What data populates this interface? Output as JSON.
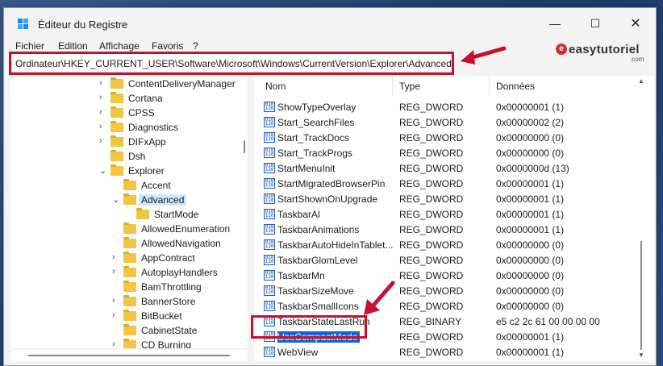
{
  "window": {
    "title": "Éditeur du Registre",
    "controls": {
      "minimize": "—",
      "maximize": "☐",
      "close": "✕"
    }
  },
  "menu": [
    "Fichier",
    "Edition",
    "Affichage",
    "Favoris",
    "?"
  ],
  "address": "Ordinateur\\HKEY_CURRENT_USER\\Software\\Microsoft\\Windows\\CurrentVersion\\Explorer\\Advanced",
  "logo": {
    "mark": "e",
    "name": "easytutoriel",
    "domain": ".com"
  },
  "tree": [
    {
      "label": "ContentDeliveryManager",
      "level": 1,
      "expander": "›"
    },
    {
      "label": "Cortana",
      "level": 1,
      "expander": "›"
    },
    {
      "label": "CPSS",
      "level": 1,
      "expander": "›"
    },
    {
      "label": "Diagnostics",
      "level": 1,
      "expander": "›"
    },
    {
      "label": "DIFxApp",
      "level": 1,
      "expander": "›"
    },
    {
      "label": "Dsh",
      "level": 1,
      "expander": ""
    },
    {
      "label": "Explorer",
      "level": 1,
      "expander": "⌄"
    },
    {
      "label": "Accent",
      "level": 2,
      "expander": ""
    },
    {
      "label": "Advanced",
      "level": 2,
      "expander": "⌄",
      "selected": true
    },
    {
      "label": "StartMode",
      "level": 3,
      "expander": ""
    },
    {
      "label": "AllowedEnumeration",
      "level": 2,
      "expander": ""
    },
    {
      "label": "AllowedNavigation",
      "level": 2,
      "expander": ""
    },
    {
      "label": "AppContract",
      "level": 2,
      "expander": "›"
    },
    {
      "label": "AutoplayHandlers",
      "level": 2,
      "expander": "›"
    },
    {
      "label": "BamThrottling",
      "level": 2,
      "expander": ""
    },
    {
      "label": "BannerStore",
      "level": 2,
      "expander": "›"
    },
    {
      "label": "BitBucket",
      "level": 2,
      "expander": "›"
    },
    {
      "label": "CabinetState",
      "level": 2,
      "expander": ""
    },
    {
      "label": "CD Burning",
      "level": 2,
      "expander": "›"
    }
  ],
  "columns": {
    "name": "Nom",
    "type": "Type",
    "data": "Données"
  },
  "values": [
    {
      "name": "ShowTypeOverlay",
      "type": "REG_DWORD",
      "data": "0x00000001 (1)"
    },
    {
      "name": "Start_SearchFiles",
      "type": "REG_DWORD",
      "data": "0x00000002 (2)"
    },
    {
      "name": "Start_TrackDocs",
      "type": "REG_DWORD",
      "data": "0x00000000 (0)"
    },
    {
      "name": "Start_TrackProgs",
      "type": "REG_DWORD",
      "data": "0x00000000 (0)"
    },
    {
      "name": "StartMenuInit",
      "type": "REG_DWORD",
      "data": "0x0000000d (13)"
    },
    {
      "name": "StartMigratedBrowserPin",
      "type": "REG_DWORD",
      "data": "0x00000001 (1)"
    },
    {
      "name": "StartShownOnUpgrade",
      "type": "REG_DWORD",
      "data": "0x00000001 (1)"
    },
    {
      "name": "TaskbarAl",
      "type": "REG_DWORD",
      "data": "0x00000001 (1)"
    },
    {
      "name": "TaskbarAnimations",
      "type": "REG_DWORD",
      "data": "0x00000001 (1)"
    },
    {
      "name": "TaskbarAutoHideInTablet...",
      "type": "REG_DWORD",
      "data": "0x00000000 (0)"
    },
    {
      "name": "TaskbarGlomLevel",
      "type": "REG_DWORD",
      "data": "0x00000000 (0)"
    },
    {
      "name": "TaskbarMn",
      "type": "REG_DWORD",
      "data": "0x00000000 (0)"
    },
    {
      "name": "TaskbarSizeMove",
      "type": "REG_DWORD",
      "data": "0x00000000 (0)"
    },
    {
      "name": "TaskbarSmallIcons",
      "type": "REG_DWORD",
      "data": "0x00000000 (0)"
    },
    {
      "name": "TaskbarStateLastRun",
      "type": "REG_BINARY",
      "data": "e5 c2 2c 61 00 00 00 00"
    },
    {
      "name": "UseCompactMode",
      "type": "REG_DWORD",
      "data": "0x00000001 (1)",
      "selected": true
    },
    {
      "name": "WebView",
      "type": "REG_DWORD",
      "data": "0x00000001 (1)"
    }
  ],
  "colors": {
    "annotation": "#c8102e",
    "selection": "#0a64d7",
    "folder": "#f4c542"
  }
}
